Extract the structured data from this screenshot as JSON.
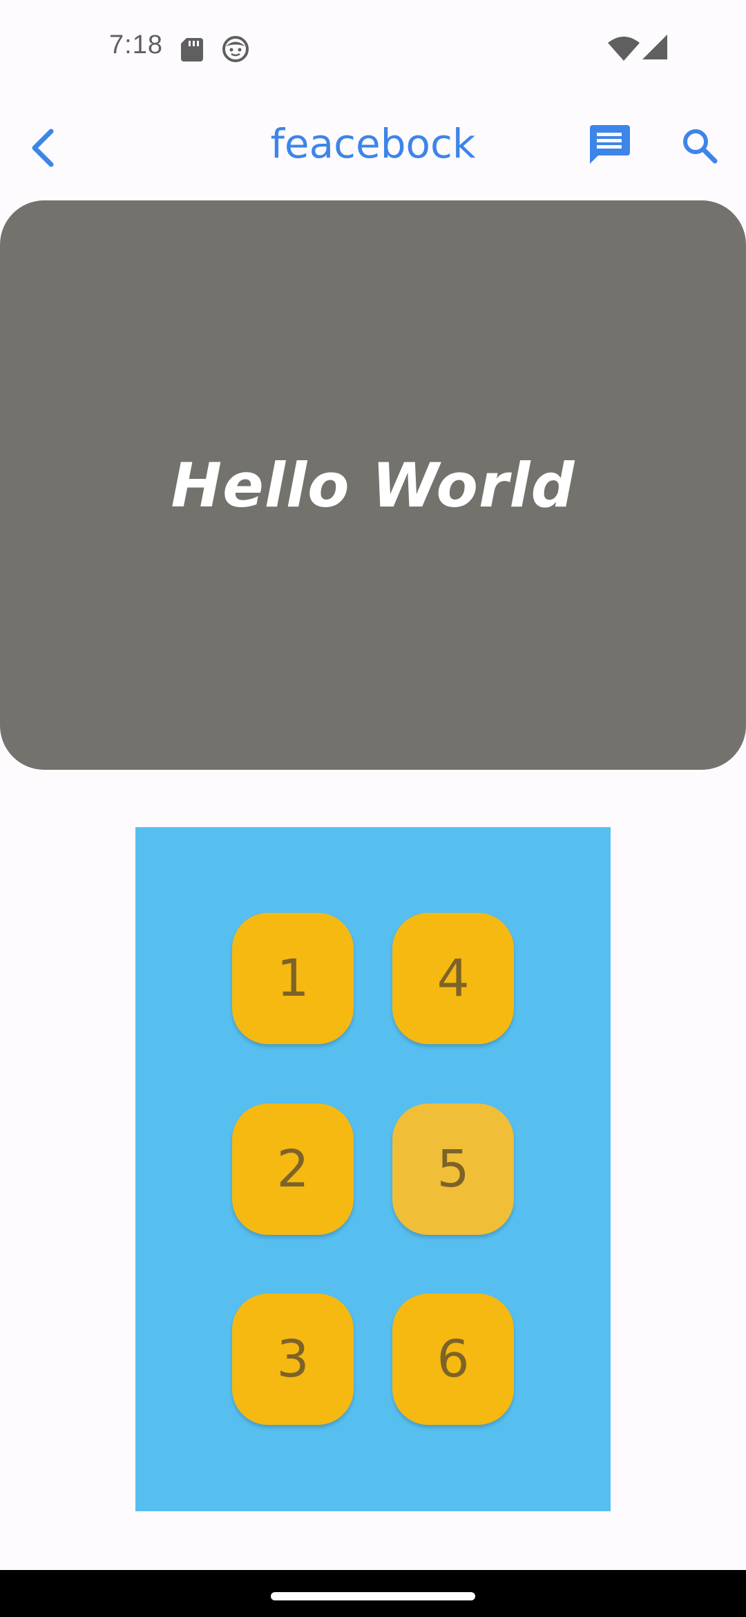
{
  "status_bar": {
    "time": "7:18",
    "icons": [
      "sd-card-icon",
      "face-icon",
      "wifi-icon",
      "signal-icon"
    ]
  },
  "app_bar": {
    "title": "feacebock",
    "accent_color": "#3D85E8",
    "icons": [
      "back-arrow-icon",
      "message-icon",
      "search-icon"
    ]
  },
  "hero": {
    "text": "Hello World",
    "background_color": "#74726D"
  },
  "grid": {
    "background_color": "#57BFF0",
    "tile_color": "#F5B912",
    "tiles": [
      {
        "label": "1"
      },
      {
        "label": "4"
      },
      {
        "label": "2"
      },
      {
        "label": "5"
      },
      {
        "label": "3"
      },
      {
        "label": "6"
      }
    ]
  }
}
